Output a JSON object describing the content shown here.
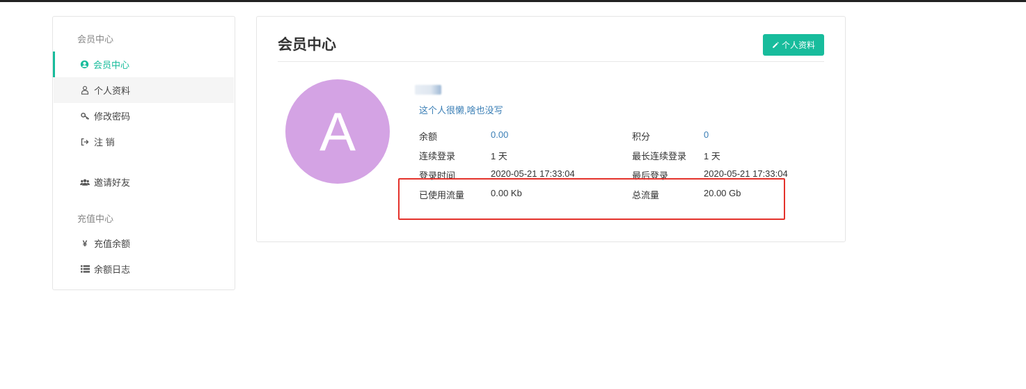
{
  "sidebar": {
    "section_member": "会员中心",
    "items": [
      {
        "label": "会员中心",
        "icon": "user-circle-icon"
      },
      {
        "label": "个人资料",
        "icon": "user-outline-icon"
      },
      {
        "label": "修改密码",
        "icon": "key-icon"
      },
      {
        "label": "注 销",
        "icon": "sign-out-icon"
      },
      {
        "label": "邀请好友",
        "icon": "users-icon"
      }
    ],
    "section_recharge": "充值中心",
    "recharge_items": [
      {
        "label": "充值余额",
        "icon": "yen-icon"
      },
      {
        "label": "余额日志",
        "icon": "list-icon"
      }
    ]
  },
  "panel": {
    "title": "会员中心",
    "profile_button": "个人资料",
    "avatar_letter": "A",
    "bio": "这个人很懒,啥也没写",
    "info": {
      "balance_label": "余额",
      "balance_value": "0.00",
      "points_label": "积分",
      "points_value": "0",
      "consecutive_label": "连续登录",
      "consecutive_value": "1 天",
      "longest_label": "最长连续登录",
      "longest_value": "1 天",
      "login_time_label": "登录时间",
      "login_time_value": "2020-05-21 17:33:04",
      "last_login_label": "最后登录",
      "last_login_value": "2020-05-21 17:33:04",
      "used_traffic_label": "已使用流量",
      "used_traffic_value": "0.00 Kb",
      "total_traffic_label": "总流量",
      "total_traffic_value": "20.00 Gb"
    }
  },
  "colors": {
    "accent": "#18bc9c",
    "link": "#3b7fb6",
    "avatar_bg": "#d4a3e4",
    "highlight": "#e4322b"
  }
}
